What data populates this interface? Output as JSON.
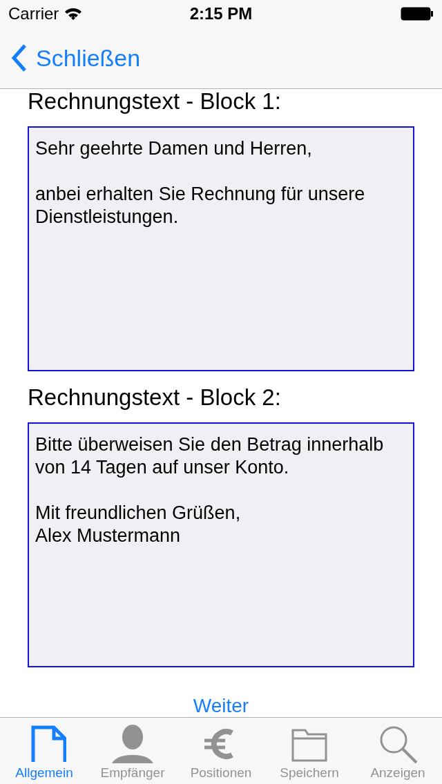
{
  "status_bar": {
    "carrier": "Carrier",
    "time": "2:15 PM"
  },
  "nav": {
    "back": "Schließen"
  },
  "blocks": [
    {
      "label": "Rechnungstext - Block 1:",
      "value": "Sehr geehrte Damen und Herren,\n\nanbei erhalten Sie Rechnung für unsere Dienstleistungen."
    },
    {
      "label": "Rechnungstext - Block 2:",
      "value": "Bitte überweisen Sie den Betrag innerhalb von 14 Tagen auf unser Konto.\n\nMit freundlichen Grüßen,\nAlex Mustermann"
    }
  ],
  "next_button": "Weiter",
  "tabs": [
    {
      "label": "Allgemein",
      "selected": true
    },
    {
      "label": "Empfänger",
      "selected": false
    },
    {
      "label": "Positionen",
      "selected": false
    },
    {
      "label": "Speichern",
      "selected": false
    },
    {
      "label": "Anzeigen",
      "selected": false
    }
  ]
}
